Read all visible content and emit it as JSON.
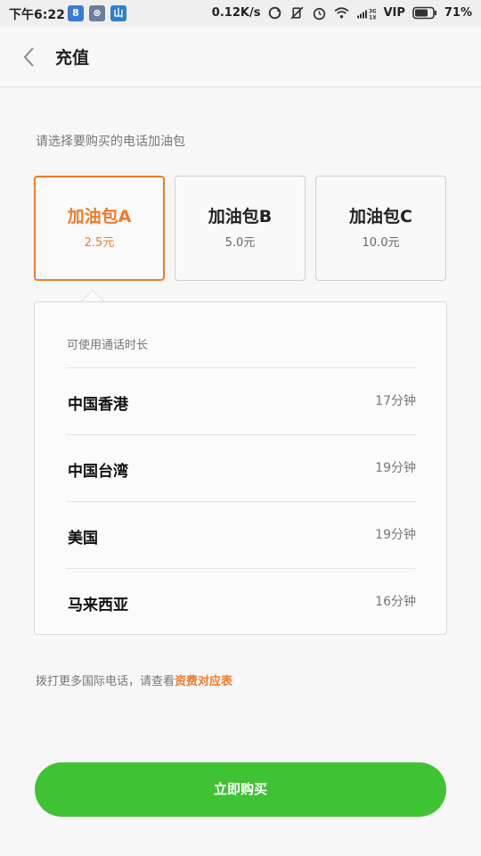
{
  "status_bar": {
    "time": "下午6:22",
    "apps": [
      "8",
      "⊗",
      "山"
    ],
    "speed": "0.12K/s",
    "carrier": "VIP",
    "battery_level": 0.71,
    "battery": "71%"
  },
  "header": {
    "title": "充值"
  },
  "prompt": "请选择要购买的电话加油包",
  "packages": [
    {
      "name": "加油包A",
      "price": "2.5元",
      "selected": true
    },
    {
      "name": "加油包B",
      "price": "5.0元",
      "selected": false
    },
    {
      "name": "加油包C",
      "price": "10.0元",
      "selected": false
    }
  ],
  "details": {
    "label": "可使用通话时长",
    "rows": [
      {
        "region": "中国香港",
        "minutes": "17分钟"
      },
      {
        "region": "中国台湾",
        "minutes": "19分钟"
      },
      {
        "region": "美国",
        "minutes": "19分钟"
      },
      {
        "region": "马来西亚",
        "minutes": "16分钟"
      }
    ]
  },
  "note": {
    "text": "拨打更多国际电话，请查看",
    "link": "资费对应表"
  },
  "buy_button": "立即购买",
  "colors": {
    "accent": "#f07a2b",
    "buy": "#3fc334"
  }
}
